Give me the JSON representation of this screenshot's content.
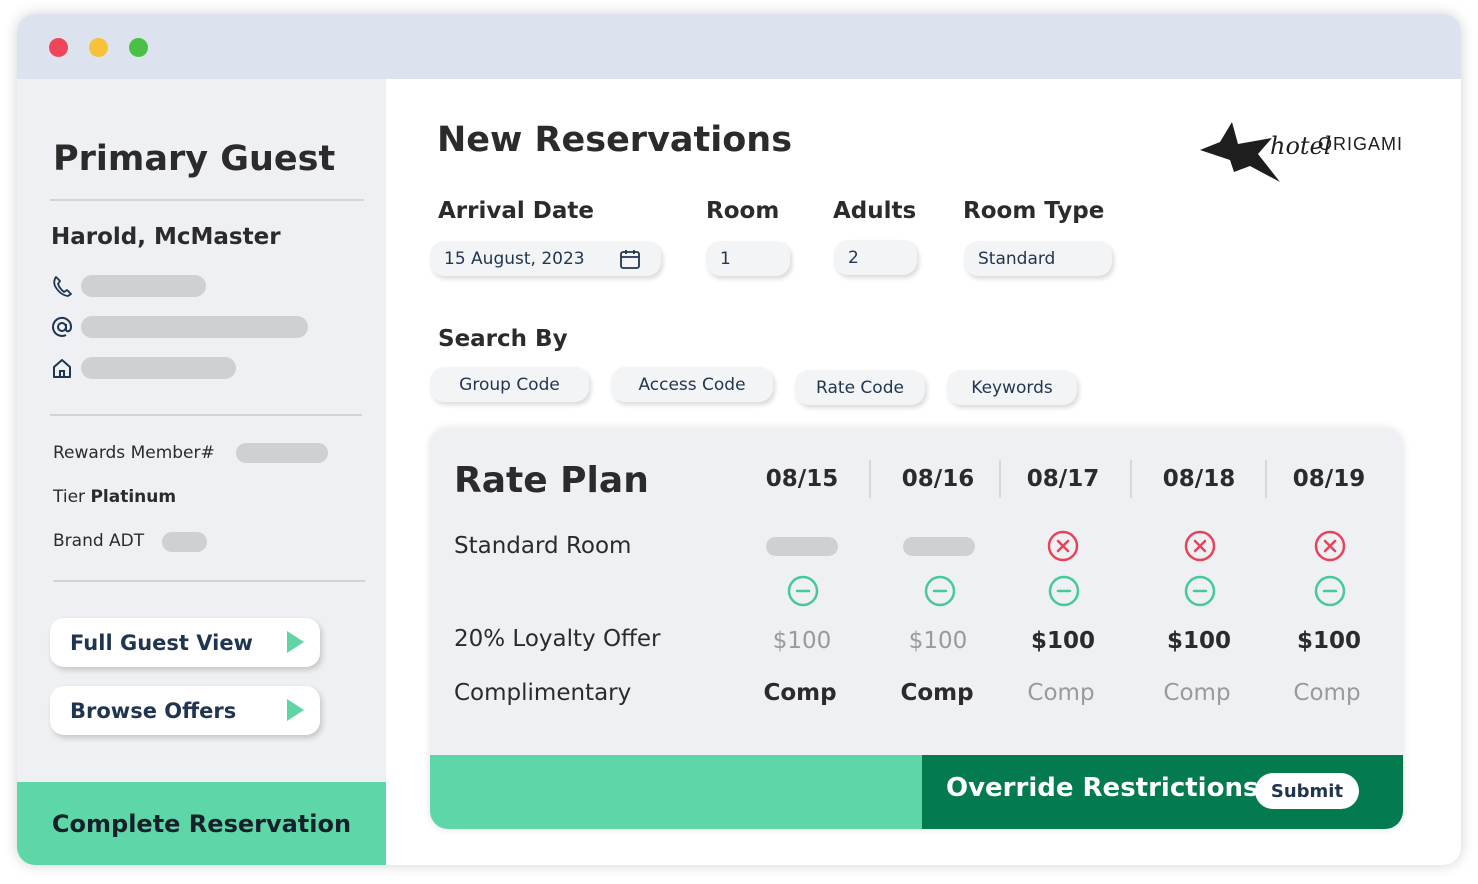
{
  "sidebar": {
    "title": "Primary Guest",
    "guest_name": "Harold, McMaster",
    "contact_icons": [
      "phone-icon",
      "at-icon",
      "home-icon"
    ],
    "rewards_label": "Rewards Member#",
    "tier_label": "Tier",
    "tier_value": "Platinum",
    "brand_label": "Brand ADT",
    "buttons": [
      {
        "label": "Full Guest View",
        "icon": "play-icon"
      },
      {
        "label": "Browse Offers",
        "icon": "play-icon"
      }
    ],
    "complete_label": "Complete Reservation"
  },
  "main": {
    "title": "New Reservations",
    "logo": {
      "script": "hotel",
      "name": "ORIGAMI",
      "icon": "origami-bird-logo"
    },
    "fields": {
      "arrival": {
        "label": "Arrival Date",
        "value": "15 August, 2023",
        "icon": "calendar-icon"
      },
      "room": {
        "label": "Room",
        "value": "1"
      },
      "adults": {
        "label": "Adults",
        "value": "2"
      },
      "room_type": {
        "label": "Room Type",
        "value": "Standard"
      }
    },
    "search": {
      "label": "Search By",
      "options": [
        "Group Code",
        "Access Code",
        "Rate Code",
        "Keywords"
      ]
    }
  },
  "rate_plan": {
    "title": "Rate Plan",
    "dates": [
      "08/15",
      "08/16",
      "08/17",
      "08/18",
      "08/19"
    ],
    "rows": {
      "standard_room": {
        "label": "Standard Room",
        "status": [
          "placeholder",
          "placeholder",
          "closed",
          "closed",
          "closed"
        ]
      },
      "availability": {
        "status": [
          "minus",
          "minus",
          "minus",
          "minus",
          "minus"
        ]
      },
      "loyalty": {
        "label": "20% Loyalty Offer",
        "values": [
          "$100",
          "$100",
          "$100",
          "$100",
          "$100"
        ],
        "emphasis": [
          false,
          false,
          true,
          true,
          true
        ]
      },
      "complimentary": {
        "label": "Complimentary",
        "values": [
          "Comp",
          "Comp",
          "Comp",
          "Comp",
          "Comp"
        ],
        "emphasis": [
          true,
          true,
          false,
          false,
          false
        ]
      }
    },
    "footer": {
      "override_label": "Override Restrictions",
      "submit_label": "Submit"
    }
  },
  "colors": {
    "accent_green": "#5dd6a8",
    "dark_green": "#047a4f",
    "closed_red": "#e8435a",
    "minus_green": "#45c998",
    "titlebar": "#dde3ee"
  }
}
